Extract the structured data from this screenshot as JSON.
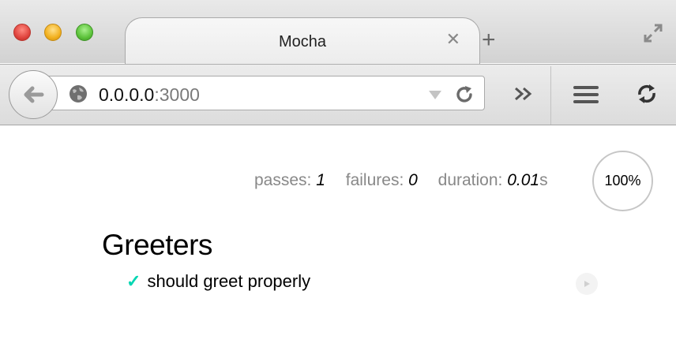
{
  "window": {
    "tab_title": "Mocha",
    "tab_close": "✕",
    "new_tab": "+"
  },
  "toolbar": {
    "url_host": "0.0.0.0",
    "url_port": ":3000",
    "overflow": "»"
  },
  "report": {
    "passes_label": "passes:",
    "passes_value": "1",
    "failures_label": "failures:",
    "failures_value": "0",
    "duration_label": "duration:",
    "duration_value": "0.01",
    "duration_unit": "s",
    "progress": "100%"
  },
  "suite": {
    "title": "Greeters",
    "tests": [
      {
        "status": "✓",
        "title": "should greet properly"
      }
    ]
  },
  "colors": {
    "pass_check": "#00d6b2",
    "stat_label": "#888888"
  },
  "icons": [
    "back-arrow-icon",
    "globe-icon",
    "dropdown-icon",
    "reload-icon",
    "overflow-chevron-icon",
    "hamburger-menu-icon",
    "sync-icon",
    "fullscreen-icon",
    "replay-icon"
  ]
}
